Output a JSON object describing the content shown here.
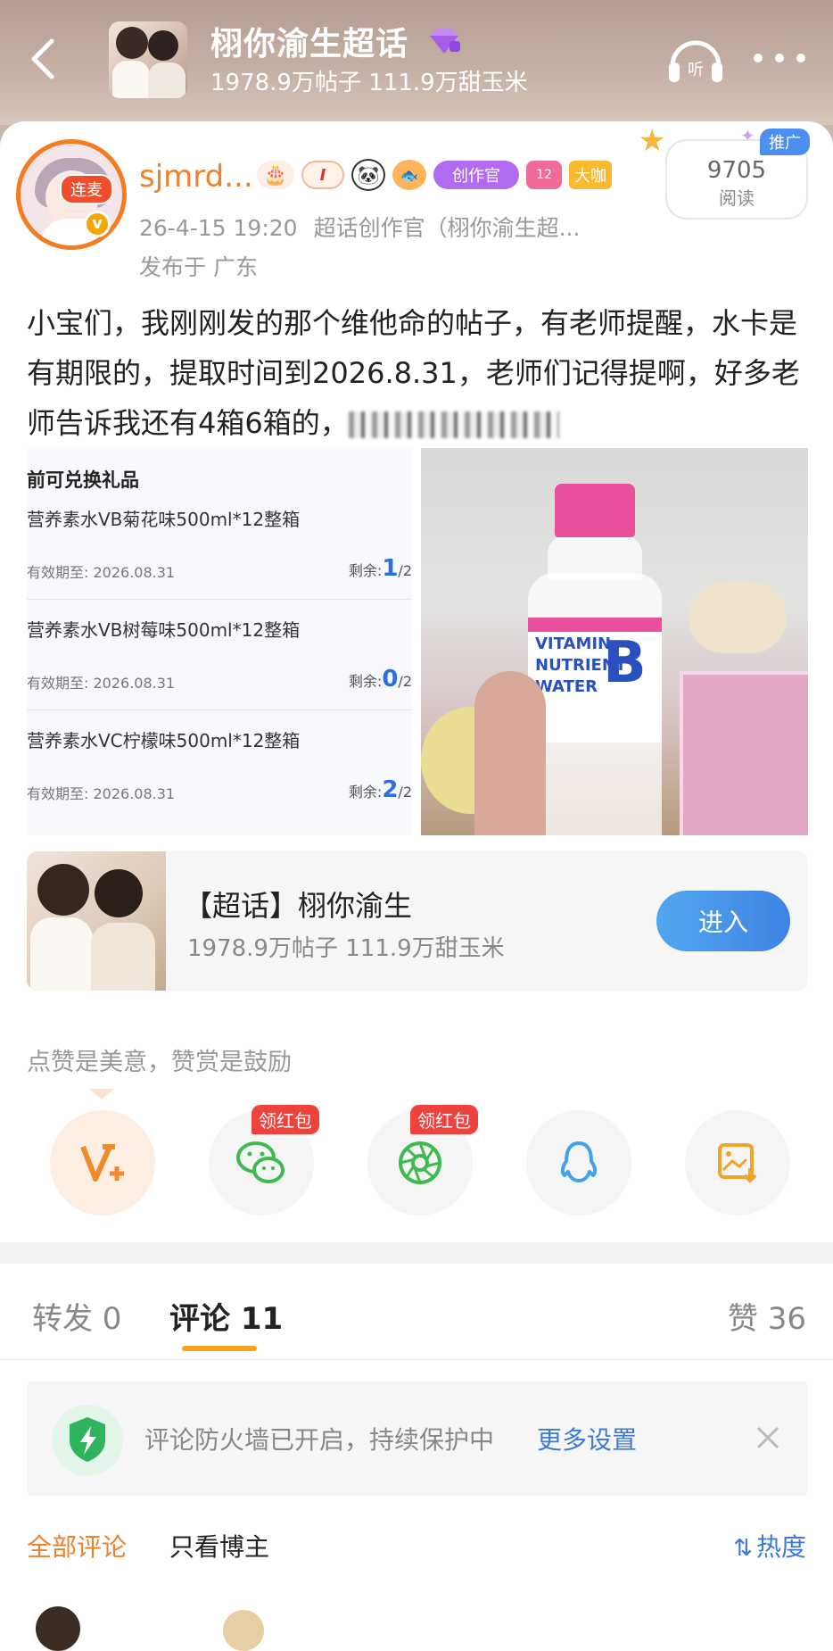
{
  "header": {
    "title": "栩你渝生超话",
    "stats": "1978.9万帖子 111.9万甜玉米"
  },
  "post": {
    "avatar_tag": "连麦",
    "verify_mark": "v",
    "username": "sjmrd...",
    "badges": {
      "i_badge": "I",
      "creator": "创作官",
      "gem_level": "12",
      "big_shot": "大咖"
    },
    "promo_label": "推广",
    "read_count": "9705",
    "read_label": "阅读",
    "timestamp": "26-4-15 19:20",
    "source": "超话创作官（栩你渝生超...",
    "location": "发布于 广东",
    "text": "小宝们，我刚刚发的那个维他命的帖子，有老师提醒，水卡是有期限的，提取时间到2026.8.31，老师们记得提啊，好多老师告诉我还有4箱6箱的，"
  },
  "gift_image": {
    "heading": "前可兑换礼品",
    "items": [
      {
        "name": "营养素水VB菊花味500ml*12整箱",
        "expiry": "有效期至: 2026.08.31",
        "remain_label": "剩余:",
        "remain": "1",
        "remain_total": "/2"
      },
      {
        "name": "营养素水VB树莓味500ml*12整箱",
        "expiry": "有效期至: 2026.08.31",
        "remain_label": "剩余:",
        "remain": "0",
        "remain_total": "/2"
      },
      {
        "name": "营养素水VC柠檬味500ml*12整箱",
        "expiry": "有效期至: 2026.08.31",
        "remain_label": "剩余:",
        "remain": "2",
        "remain_total": "/2"
      }
    ]
  },
  "bottle_image": {
    "label_text": "VITAMIN NUTRIENT WATER",
    "label_letter": "B"
  },
  "topic_card": {
    "title": "【超话】栩你渝生",
    "stats": "1978.9万帖子 111.9万甜玉米",
    "enter_label": "进入"
  },
  "reward": {
    "text": "点赞是美意，赞赏是鼓励",
    "hongbao_label": "领红包"
  },
  "tabs": {
    "repost": "转发 0",
    "comment": "评论 11",
    "like": "赞 36"
  },
  "firewall": {
    "text": "评论防火墙已开启，持续保护中",
    "link": "更多设置"
  },
  "comment_filters": {
    "all": "全部评论",
    "author_only": "只看博主",
    "sort": "热度"
  },
  "colors": {
    "accent_orange": "#f0802a",
    "link_blue": "#3c7ad6",
    "enter_blue": "#4a95ea",
    "hongbao_red": "#f0423d",
    "tab_indicator": "#f7a21b"
  }
}
